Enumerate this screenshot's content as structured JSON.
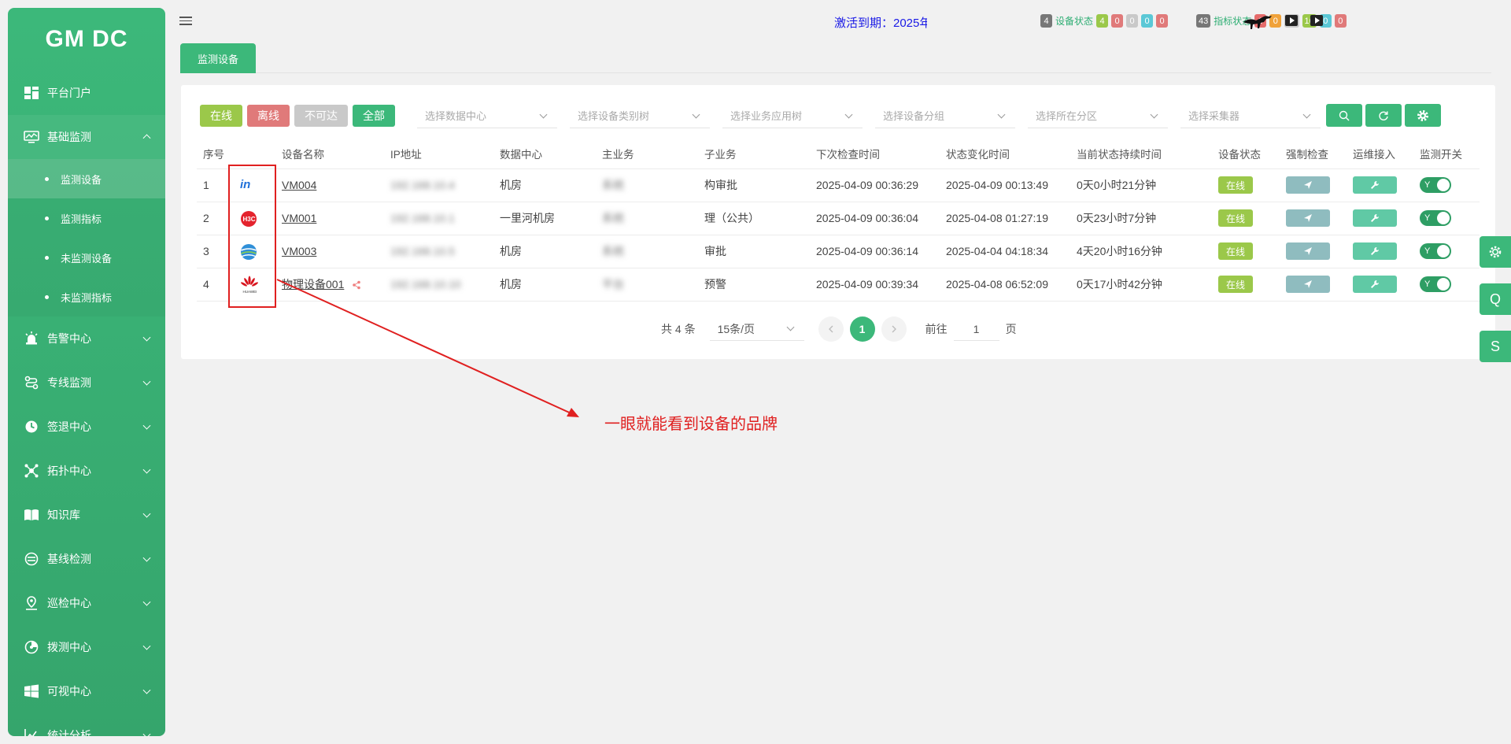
{
  "app": {
    "logo": "GM DC"
  },
  "sidebar": {
    "items": [
      {
        "label": "平台门户",
        "icon": "dashboard-icon"
      },
      {
        "label": "基础监测",
        "icon": "monitor-icon",
        "open": true
      },
      {
        "label": "告警中心",
        "icon": "alarm-icon"
      },
      {
        "label": "专线监测",
        "icon": "route-icon"
      },
      {
        "label": "签退中心",
        "icon": "clock-icon"
      },
      {
        "label": "拓扑中心",
        "icon": "topology-icon"
      },
      {
        "label": "知识库",
        "icon": "book-icon"
      },
      {
        "label": "基线检测",
        "icon": "baseline-icon"
      },
      {
        "label": "巡检中心",
        "icon": "location-icon"
      },
      {
        "label": "拨测中心",
        "icon": "dial-icon"
      },
      {
        "label": "可视中心",
        "icon": "windows-icon"
      },
      {
        "label": "统计分析",
        "icon": "chart-icon"
      }
    ],
    "subitems": [
      {
        "label": "监测设备",
        "active": true
      },
      {
        "label": "监测指标"
      },
      {
        "label": "未监测设备"
      },
      {
        "label": "未监测指标"
      }
    ]
  },
  "header": {
    "activation": "激活到期：2025年",
    "device_status": {
      "total": "4",
      "label": "设备状态",
      "counts": [
        "4",
        "0",
        "0",
        "0",
        "0"
      ]
    },
    "metric_status": {
      "total": "43",
      "label": "指标状态",
      "counts": [
        "6",
        "0",
        "21",
        "16",
        "0",
        "0"
      ]
    }
  },
  "tab": {
    "label": "监测设备"
  },
  "filters": {
    "buttons": [
      "在线",
      "离线",
      "不可达",
      "全部"
    ],
    "selects": [
      "选择数据中心",
      "选择设备类别树",
      "选择业务应用树",
      "选择设备分组",
      "选择所在分区",
      "选择采集器"
    ]
  },
  "table": {
    "headers": [
      "序号",
      "",
      "设备名称",
      "IP地址",
      "数据中心",
      "主业务",
      "子业务",
      "下次检查时间",
      "状态变化时间",
      "当前状态持续时间",
      "设备状态",
      "强制检查",
      "运维接入",
      "监测开关"
    ],
    "rows": [
      {
        "no": "1",
        "brand": "inspur",
        "name": "VM004",
        "ip": "192.168.10.4",
        "dc": "机房",
        "main": "系统",
        "sub": "构审批",
        "next": "2025-04-09 00:36:29",
        "change": "2025-04-09 00:13:49",
        "duration": "0天0小时21分钟",
        "status": "在线",
        "switch": "Y"
      },
      {
        "no": "2",
        "brand": "h3c",
        "name": "VM001",
        "ip": "192.168.10.1",
        "dc": "一里河机房",
        "main": "系统",
        "sub": "理（公共）",
        "next": "2025-04-09 00:36:04",
        "change": "2025-04-08 01:27:19",
        "duration": "0天23小时7分钟",
        "status": "在线",
        "switch": "Y"
      },
      {
        "no": "3",
        "brand": "ruijie",
        "name": "VM003",
        "ip": "192.168.10.5",
        "dc": "机房",
        "main": "系统",
        "sub": "审批",
        "next": "2025-04-09 00:36:14",
        "change": "2025-04-04 04:18:34",
        "duration": "4天20小时16分钟",
        "status": "在线",
        "switch": "Y"
      },
      {
        "no": "4",
        "brand": "huawei",
        "name": "物理设备001",
        "ip": "192.168.10.10",
        "dc": "机房",
        "main": "平台",
        "sub": "预警",
        "next": "2025-04-09 00:39:34",
        "change": "2025-04-08 06:52:09",
        "duration": "0天17小时42分钟",
        "status": "在线",
        "switch": "Y"
      }
    ]
  },
  "pagination": {
    "total": "共 4 条",
    "page_size": "15条/页",
    "current": "1",
    "goto_label": "前往",
    "goto_value": "1",
    "page_suffix": "页"
  },
  "annotation": {
    "text": "一眼就能看到设备的品牌"
  },
  "floating": [
    "gear-icon",
    "Q",
    "S"
  ],
  "colors": {
    "accent": "#3cb87a",
    "online": "#9bc84a",
    "offline": "#e07a7a",
    "unreachable": "#c9c9c9",
    "annotation": "#e02020"
  }
}
